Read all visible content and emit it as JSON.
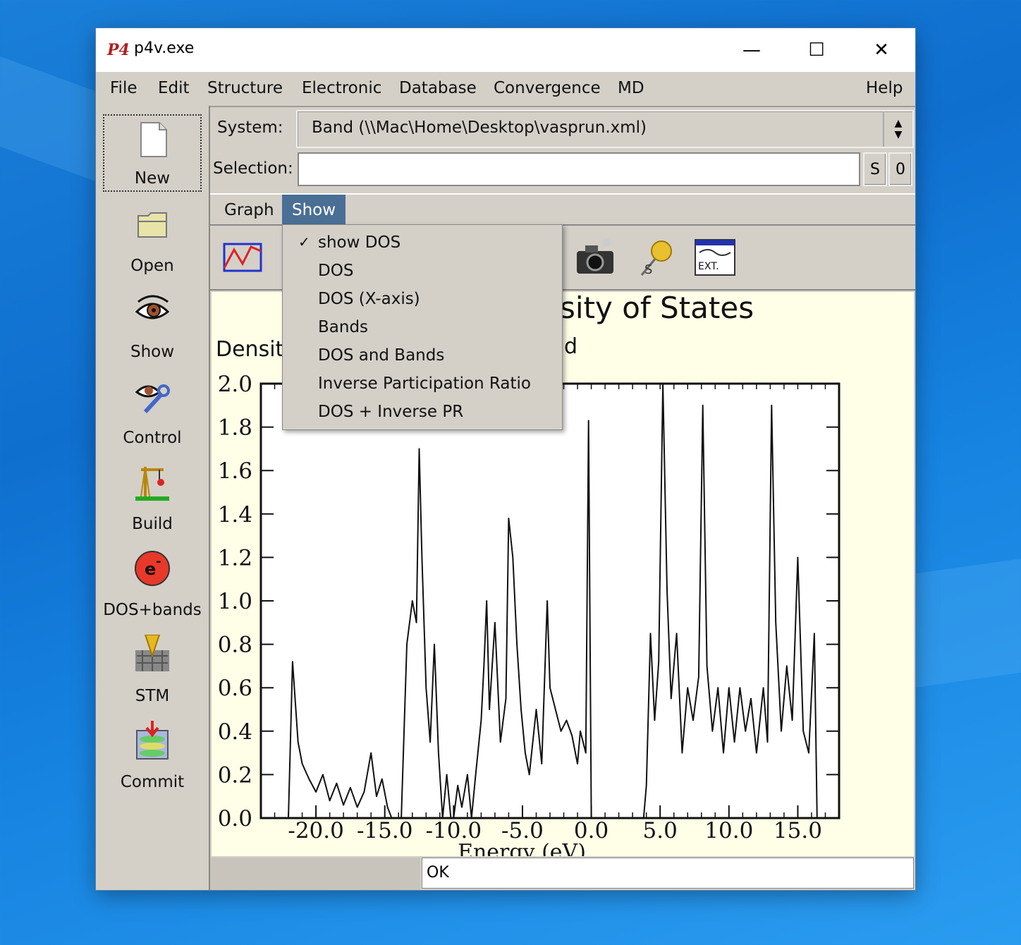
{
  "window": {
    "title": "p4v.exe",
    "icon_text": "P4",
    "controls": {
      "minimize": "—",
      "maximize": "☐",
      "close": "✕"
    }
  },
  "menubar": [
    "File",
    "Edit",
    "Structure",
    "Electronic",
    "Database",
    "Convergence",
    "MD",
    "Help"
  ],
  "sidebar": {
    "tools": [
      {
        "label": "New",
        "icon": "new-document-icon"
      },
      {
        "label": "Open",
        "icon": "folder-icon"
      },
      {
        "label": "Show",
        "icon": "eye-icon"
      },
      {
        "label": "Control",
        "icon": "eye-wrench-icon"
      },
      {
        "label": "Build",
        "icon": "crane-icon"
      },
      {
        "label": "DOS+bands",
        "icon": "electron-icon"
      },
      {
        "label": "STM",
        "icon": "stm-tip-icon"
      },
      {
        "label": "Commit",
        "icon": "database-commit-icon"
      }
    ]
  },
  "system": {
    "label": "System:",
    "value": "Band (\\\\Mac\\Home\\Desktop\\vasprun.xml)"
  },
  "selection": {
    "label": "Selection:",
    "value": "",
    "buttons": [
      "S",
      "0"
    ]
  },
  "tabs": [
    {
      "label": "Graph",
      "active": false
    },
    {
      "label": "Show",
      "active": true
    }
  ],
  "toolbar_icons": [
    "graph-line-icon",
    "camera-icon",
    "pushpin-icon",
    "ext-window-icon"
  ],
  "ext_icon_text": "EXT.",
  "dropdown": {
    "items": [
      {
        "label": "show DOS",
        "checked": true
      },
      {
        "label": "DOS",
        "checked": false
      },
      {
        "label": "DOS (X-axis)",
        "checked": false
      },
      {
        "label": "Bands",
        "checked": false
      },
      {
        "label": "DOS and Bands",
        "checked": false
      },
      {
        "label": "Inverse Participation Ratio",
        "checked": false
      },
      {
        "label": "DOS + Inverse PR",
        "checked": false
      }
    ]
  },
  "graph": {
    "title_visible": "sity of States",
    "subtitle_left": "Density",
    "subtitle_right": "d"
  },
  "chart_data": {
    "type": "line",
    "title": "",
    "xlabel": "Energy (eV)",
    "ylabel": "",
    "xlim": [
      -24,
      18
    ],
    "ylim": [
      0,
      2.0
    ],
    "x_ticks": [
      "-20.0",
      "-15.0",
      "-10.0",
      "-5.0",
      "0.0",
      "5.0",
      "10.0",
      "15.0"
    ],
    "y_ticks": [
      "0.0",
      "0.2",
      "0.4",
      "0.6",
      "0.8",
      "1.0",
      "1.2",
      "1.4",
      "1.6",
      "1.8",
      "2.0"
    ],
    "series": [
      {
        "values": [
          [
            -22.0,
            0.0
          ],
          [
            -21.7,
            0.72
          ],
          [
            -21.3,
            0.35
          ],
          [
            -21.0,
            0.25
          ],
          [
            -20.5,
            0.18
          ],
          [
            -20.0,
            0.12
          ],
          [
            -19.5,
            0.2
          ],
          [
            -19.0,
            0.08
          ],
          [
            -18.5,
            0.16
          ],
          [
            -18.0,
            0.06
          ],
          [
            -17.5,
            0.14
          ],
          [
            -17.0,
            0.05
          ],
          [
            -16.5,
            0.12
          ],
          [
            -16.0,
            0.3
          ],
          [
            -15.6,
            0.1
          ],
          [
            -15.2,
            0.18
          ],
          [
            -14.8,
            0.05
          ],
          [
            -14.5,
            0.0
          ],
          [
            -13.8,
            0.0
          ],
          [
            -13.4,
            0.8
          ],
          [
            -13.0,
            1.0
          ],
          [
            -12.7,
            0.9
          ],
          [
            -12.5,
            1.7
          ],
          [
            -12.3,
            1.2
          ],
          [
            -12.0,
            0.6
          ],
          [
            -11.7,
            0.35
          ],
          [
            -11.4,
            0.8
          ],
          [
            -11.1,
            0.3
          ],
          [
            -10.8,
            0.0
          ],
          [
            -10.5,
            0.2
          ],
          [
            -10.2,
            0.0
          ],
          [
            -10.0,
            0.0
          ],
          [
            -9.7,
            0.15
          ],
          [
            -9.4,
            0.05
          ],
          [
            -9.0,
            0.2
          ],
          [
            -8.7,
            0.0
          ],
          [
            -8.4,
            0.2
          ],
          [
            -8.0,
            0.45
          ],
          [
            -7.8,
            0.7
          ],
          [
            -7.6,
            1.0
          ],
          [
            -7.4,
            0.5
          ],
          [
            -7.0,
            0.9
          ],
          [
            -6.6,
            0.35
          ],
          [
            -6.2,
            0.55
          ],
          [
            -6.0,
            1.38
          ],
          [
            -5.7,
            1.2
          ],
          [
            -5.4,
            0.8
          ],
          [
            -5.1,
            0.5
          ],
          [
            -4.8,
            0.3
          ],
          [
            -4.5,
            0.2
          ],
          [
            -4.0,
            0.5
          ],
          [
            -3.6,
            0.25
          ],
          [
            -3.2,
            1.0
          ],
          [
            -3.0,
            0.6
          ],
          [
            -2.6,
            0.5
          ],
          [
            -2.2,
            0.4
          ],
          [
            -1.8,
            0.45
          ],
          [
            -1.4,
            0.38
          ],
          [
            -1.0,
            0.25
          ],
          [
            -0.8,
            0.4
          ],
          [
            -0.4,
            0.3
          ],
          [
            -0.2,
            1.83
          ],
          [
            0.0,
            0.0
          ],
          [
            3.8,
            0.0
          ],
          [
            4.0,
            0.15
          ],
          [
            4.3,
            0.85
          ],
          [
            4.6,
            0.45
          ],
          [
            4.9,
            0.72
          ],
          [
            5.2,
            2.0
          ],
          [
            5.5,
            1.05
          ],
          [
            5.8,
            0.55
          ],
          [
            6.2,
            0.85
          ],
          [
            6.6,
            0.3
          ],
          [
            7.0,
            0.6
          ],
          [
            7.4,
            0.45
          ],
          [
            7.8,
            0.65
          ],
          [
            8.1,
            1.9
          ],
          [
            8.4,
            0.7
          ],
          [
            8.8,
            0.4
          ],
          [
            9.2,
            0.6
          ],
          [
            9.6,
            0.3
          ],
          [
            10.0,
            0.6
          ],
          [
            10.4,
            0.35
          ],
          [
            10.8,
            0.6
          ],
          [
            11.2,
            0.4
          ],
          [
            11.6,
            0.55
          ],
          [
            12.0,
            0.3
          ],
          [
            12.5,
            0.6
          ],
          [
            12.8,
            0.35
          ],
          [
            13.1,
            1.9
          ],
          [
            13.4,
            0.9
          ],
          [
            13.8,
            0.4
          ],
          [
            14.2,
            0.7
          ],
          [
            14.6,
            0.45
          ],
          [
            15.0,
            1.2
          ],
          [
            15.4,
            0.4
          ],
          [
            15.8,
            0.3
          ],
          [
            16.2,
            0.85
          ],
          [
            16.4,
            0.0
          ]
        ]
      }
    ]
  }
}
